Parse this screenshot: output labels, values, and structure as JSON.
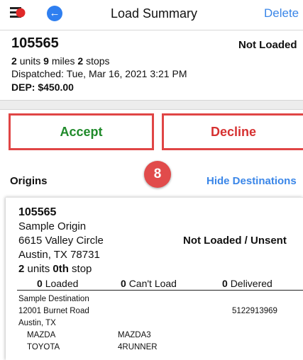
{
  "header": {
    "title": "Load Summary",
    "delete_label": "Delete",
    "back_icon": "arrow-left-icon",
    "logo_icon": "app-logo-icon"
  },
  "load": {
    "number": "105565",
    "status": "Not Loaded",
    "units_count": "2",
    "units_label": "units",
    "miles_count": "9",
    "miles_label": "miles",
    "stops_count": "2",
    "stops_label": "stops",
    "dispatched": "Dispatched: Tue, Mar 16, 2021 3:21 PM",
    "dep": "DEP: $450.00"
  },
  "actions": {
    "accept_label": "Accept",
    "decline_label": "Decline"
  },
  "step_badge": "8",
  "section": {
    "origins_label": "Origins",
    "hide_destinations_label": "Hide Destinations"
  },
  "origin": {
    "number": "105565",
    "name": "Sample Origin",
    "address": "6615 Valley Circle",
    "city": "Austin, TX 78731",
    "status": "Not Loaded / Unsent",
    "units_count": "2",
    "units_label": "units",
    "stop_number": "0th",
    "stop_label": "stop",
    "counts": {
      "loaded_value": "0",
      "loaded_label": "Loaded",
      "cant_load_value": "0",
      "cant_load_label": "Can't Load",
      "delivered_value": "0",
      "delivered_label": "Delivered"
    }
  },
  "destination": {
    "name": "Sample Destination",
    "address": "12001 Burnet Road",
    "city": "Austin, TX",
    "phone": "5122913969",
    "vehicles": [
      {
        "make": "MAZDA",
        "model": "MAZDA3"
      },
      {
        "make": "TOYOTA",
        "model": "4RUNNER"
      }
    ]
  },
  "colors": {
    "accent_blue": "#3a86e8",
    "accept_green": "#1f8a2a",
    "decline_red": "#d63131",
    "highlight_border": "#e04545",
    "badge_red": "#e14b4b"
  }
}
